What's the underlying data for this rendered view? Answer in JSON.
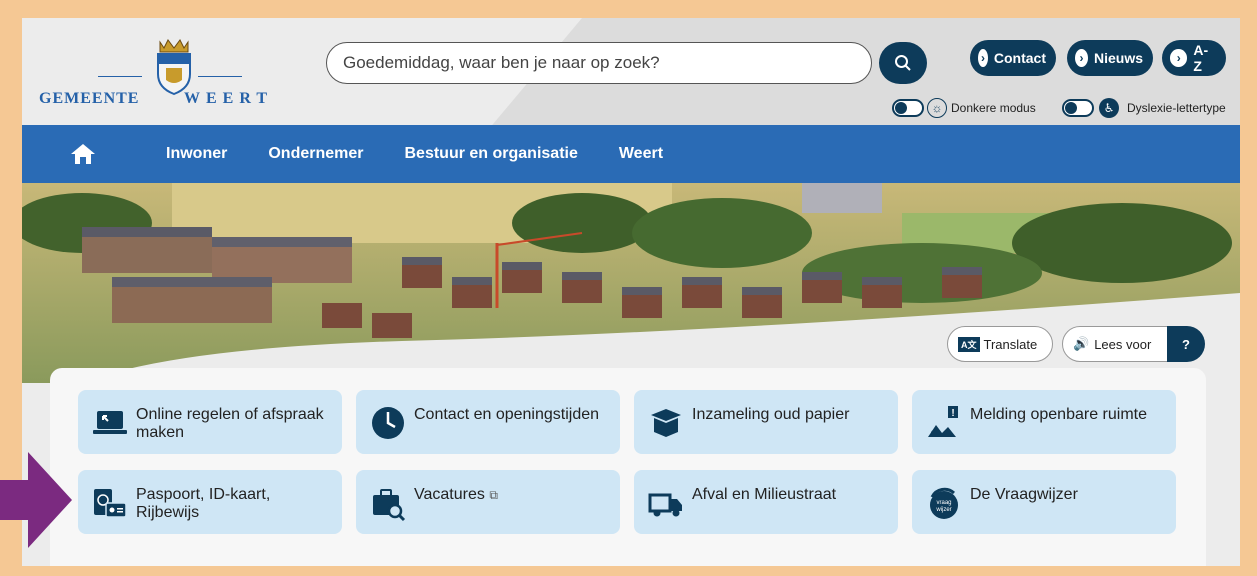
{
  "header": {
    "logo": {
      "left_text": "GEMEENTE",
      "right_text": "WEERT"
    },
    "search": {
      "placeholder": "Goedemiddag, waar ben je naar op zoek?"
    },
    "top_buttons": [
      {
        "label": "Contact"
      },
      {
        "label": "Nieuws"
      },
      {
        "label": "A-Z"
      }
    ],
    "toggles": {
      "dark_mode": "Donkere modus",
      "dyslexia": "Dyslexie-lettertype"
    }
  },
  "nav": {
    "items": [
      "Inwoner",
      "Ondernemer",
      "Bestuur en organisatie",
      "Weert"
    ]
  },
  "tools": {
    "translate": "Translate",
    "read_aloud": "Lees voor",
    "help": "?"
  },
  "tiles": [
    {
      "label": "Online regelen of afspraak maken",
      "icon": "laptop-icon"
    },
    {
      "label": "Contact en openingstijden",
      "icon": "clock-icon"
    },
    {
      "label": "Inzameling oud papier",
      "icon": "box-icon"
    },
    {
      "label": "Melding openbare ruimte",
      "icon": "report-icon"
    },
    {
      "label": "Paspoort, ID-kaart, Rijbewijs",
      "icon": "passport-icon"
    },
    {
      "label": "Vacatures",
      "icon": "briefcase-search-icon"
    },
    {
      "label": "Afval en Milieustraat",
      "icon": "truck-icon"
    },
    {
      "label": "De Vraagwijzer",
      "icon": "vraagwijzer-icon"
    }
  ],
  "colors": {
    "outer_frame": "#f5c894",
    "nav_blue": "#2a6bb5",
    "dark_navy": "#0d3b5a",
    "tile_bg": "#cfe6f5",
    "arrow_purple": "#7b2a80"
  }
}
